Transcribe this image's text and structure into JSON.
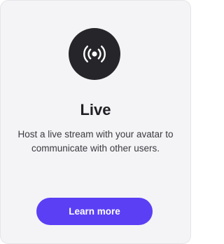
{
  "card": {
    "icon": "live-broadcast-icon",
    "title": "Live",
    "description": "Host a live stream with your avatar to communicate with other users.",
    "button_label": "Learn more"
  },
  "colors": {
    "card_background": "#f4f4f6",
    "icon_circle": "#26262a",
    "icon_glyph": "#ffffff",
    "title_text": "#1f1f24",
    "body_text": "#3a3a40",
    "button_background": "#5a3ff5",
    "button_text": "#ffffff"
  }
}
